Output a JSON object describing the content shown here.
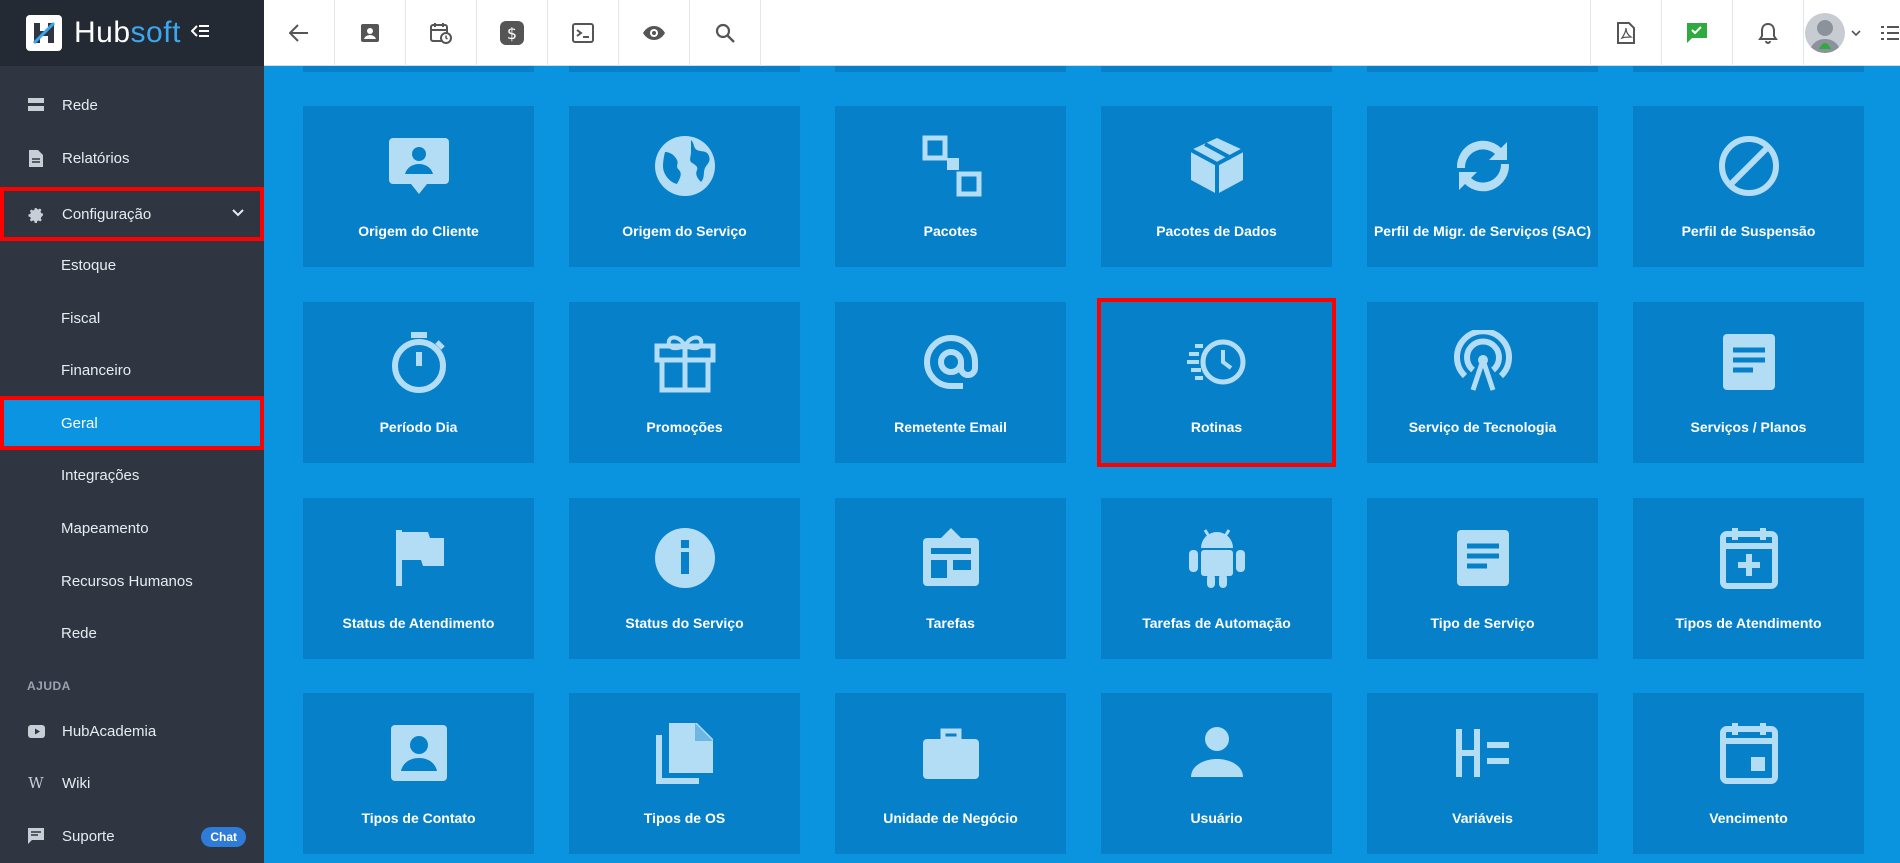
{
  "brand": {
    "name_a": "Hub",
    "name_b": "soft"
  },
  "sidebar": {
    "items": [
      {
        "label": "Rede"
      },
      {
        "label": "Relatórios"
      },
      {
        "label": "Configuração"
      },
      {
        "label": "Estoque"
      },
      {
        "label": "Fiscal"
      },
      {
        "label": "Financeiro"
      },
      {
        "label": "Geral"
      },
      {
        "label": "Integrações"
      },
      {
        "label": "Mapeamento"
      },
      {
        "label": "Recursos Humanos"
      },
      {
        "label": "Rede"
      }
    ],
    "help_title": "AJUDA",
    "help_items": [
      {
        "label": "HubAcademia"
      },
      {
        "label": "Wiki"
      },
      {
        "label": "Suporte",
        "badge": "Chat"
      }
    ]
  },
  "tiles": [
    {
      "label": "Origem do Cliente",
      "icon": "contact-card-icon"
    },
    {
      "label": "Origem do Serviço",
      "icon": "globe-icon"
    },
    {
      "label": "Pacotes",
      "icon": "squares-icon"
    },
    {
      "label": "Pacotes de Dados",
      "icon": "box-icon"
    },
    {
      "label": "Perfil de Migr. de Serviços (SAC)",
      "icon": "sync-icon"
    },
    {
      "label": "Perfil de Suspensão",
      "icon": "block-icon"
    },
    {
      "label": "Período Dia",
      "icon": "timer-icon"
    },
    {
      "label": "Promoções",
      "icon": "gift-icon"
    },
    {
      "label": "Remetente Email",
      "icon": "at-icon"
    },
    {
      "label": "Rotinas",
      "icon": "history-fast-icon"
    },
    {
      "label": "Serviço de Tecnologia",
      "icon": "antenna-icon"
    },
    {
      "label": "Serviços / Planos",
      "icon": "document-icon"
    },
    {
      "label": "Status de Atendimento",
      "icon": "flag-icon"
    },
    {
      "label": "Status do Serviço",
      "icon": "info-icon"
    },
    {
      "label": "Tarefas",
      "icon": "board-icon"
    },
    {
      "label": "Tarefas de Automação",
      "icon": "android-icon"
    },
    {
      "label": "Tipo de Serviço",
      "icon": "document-icon"
    },
    {
      "label": "Tipos de Atendimento",
      "icon": "calendar-plus-icon"
    },
    {
      "label": "Tipos de Contato",
      "icon": "contact-icon"
    },
    {
      "label": "Tipos de OS",
      "icon": "files-icon"
    },
    {
      "label": "Unidade de Negócio",
      "icon": "briefcase-icon"
    },
    {
      "label": "Usuário",
      "icon": "user-icon"
    },
    {
      "label": "Variáveis",
      "icon": "variables-icon"
    },
    {
      "label": "Vencimento",
      "icon": "calendar-icon"
    }
  ],
  "colors": {
    "accent": "#0b94e1",
    "tile": "#0680c9",
    "sidebar": "#2f3642",
    "highlight": "#ff0000"
  }
}
